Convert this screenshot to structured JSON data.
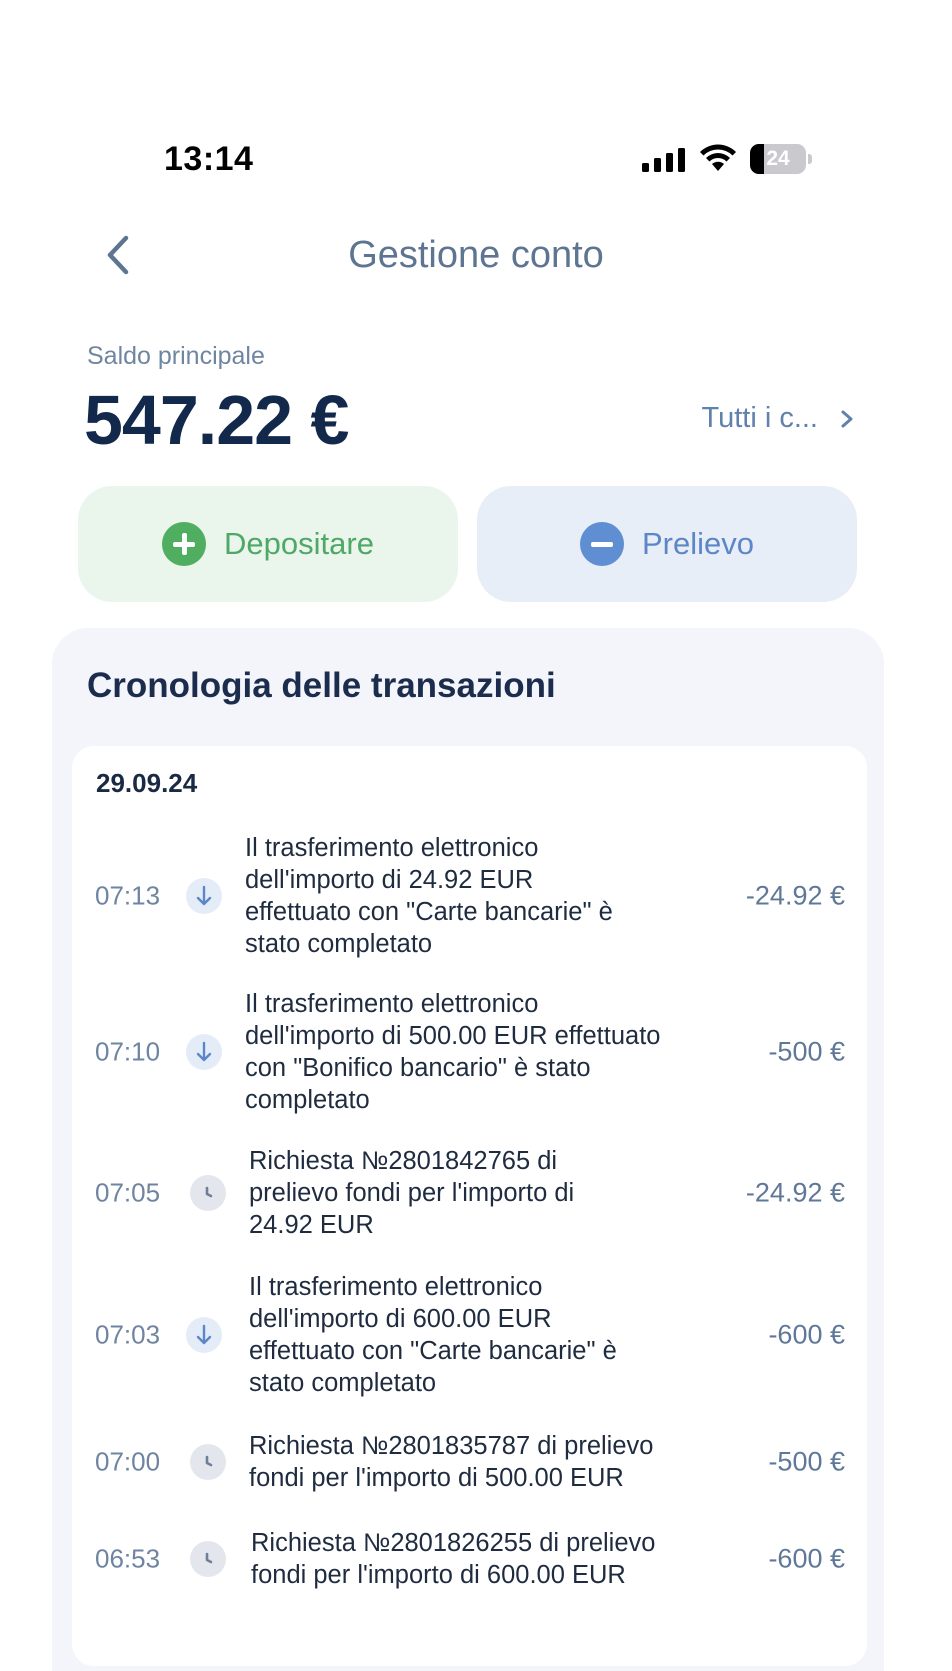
{
  "status_bar": {
    "time": "13:14",
    "battery_level": "24",
    "icons": [
      "signal-icon",
      "wifi-icon",
      "battery-icon"
    ]
  },
  "header": {
    "title": "Gestione conto",
    "back_icon": "chevron-left-icon"
  },
  "balance": {
    "label": "Saldo principale",
    "value": "547.22 €",
    "all_accounts_label": "Tutti i c...",
    "all_accounts_icon": "chevron-right-icon"
  },
  "actions": {
    "deposit_label": "Depositare",
    "deposit_icon": "plus-circle-icon",
    "deposit_color": "#4fae5f",
    "withdraw_label": "Prelievo",
    "withdraw_icon": "minus-circle-icon",
    "withdraw_color": "#5f8fd2"
  },
  "history": {
    "title": "Cronologia delle transazioni",
    "groups": [
      {
        "date": "29.09.24",
        "transactions": [
          {
            "time": "07:13",
            "icon": "arrow-down-icon",
            "description_lines": [
              "Il trasferimento elettronico",
              "dell'importo di 24.92 EUR",
              "effettuato con \"Carte bancarie\" è",
              "stato completato"
            ],
            "amount": "-24.92 €"
          },
          {
            "time": "07:10",
            "icon": "arrow-down-icon",
            "description_lines": [
              "Il trasferimento elettronico",
              "dell'importo di 500.00 EUR effettuato",
              "con \"Bonifico bancario\" è stato",
              "completato"
            ],
            "amount": "-500 €"
          },
          {
            "time": "07:05",
            "icon": "clock-icon",
            "description_lines": [
              "Richiesta №2801842765 di",
              "prelievo fondi per l'importo di",
              "24.92 EUR"
            ],
            "amount": "-24.92 €"
          },
          {
            "time": "07:03",
            "icon": "arrow-down-icon",
            "description_lines": [
              "Il trasferimento elettronico",
              "dell'importo di 600.00 EUR",
              "effettuato con \"Carte bancarie\" è",
              "stato completato"
            ],
            "amount": "-600 €"
          },
          {
            "time": "07:00",
            "icon": "clock-icon",
            "description_lines": [
              "Richiesta №2801835787 di prelievo",
              "fondi per l'importo di 500.00 EUR"
            ],
            "amount": "-500 €"
          },
          {
            "time": "06:53",
            "icon": "clock-icon",
            "description_lines": [
              "Richiesta №2801826255 di prelievo",
              "fondi per l'importo di 600.00 EUR"
            ],
            "amount": "-600 €"
          }
        ]
      }
    ]
  }
}
